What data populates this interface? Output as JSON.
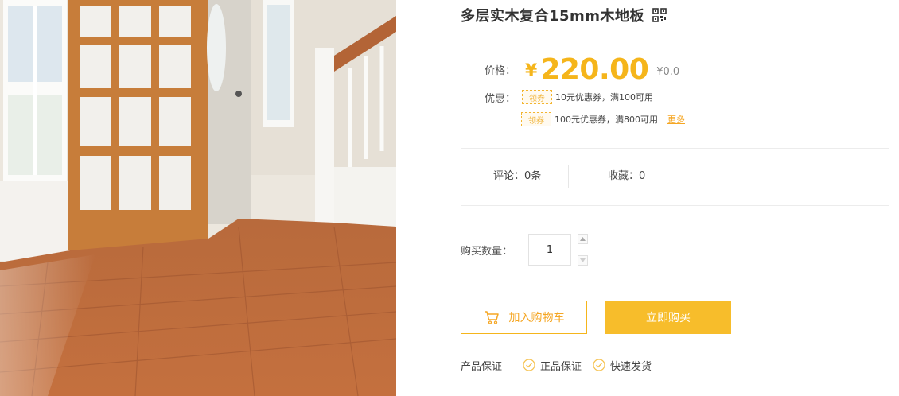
{
  "product": {
    "title": "多层实木复合15mm木地板",
    "image_alt": "木地板产品图"
  },
  "price": {
    "label": "价格：",
    "symbol": "¥",
    "value": "220.00",
    "original": "¥0.0"
  },
  "promotion": {
    "label": "优惠：",
    "coupons": [
      {
        "tag": "领券",
        "text": "10元优惠券，满100可用"
      },
      {
        "tag": "领券",
        "text": "100元优惠券，满800可用"
      }
    ],
    "more_label": "更多"
  },
  "stats": {
    "comments": "评论：0条",
    "favorites": "收藏：0"
  },
  "quantity": {
    "label": "购买数量：",
    "value": "1"
  },
  "actions": {
    "add_to_cart": "加入购物车",
    "buy_now": "立即购买"
  },
  "guarantee": {
    "label": "产品保证",
    "items": [
      "正品保证",
      "快速发货"
    ]
  },
  "colors": {
    "accent": "#f5b51b",
    "button_fill": "#f7bd2b",
    "text": "#333333"
  },
  "icons": {
    "qr": "qr-code-icon",
    "cart": "shopping-cart-icon",
    "up": "caret-up-icon",
    "down": "caret-down-icon",
    "check": "check-circle-icon"
  }
}
